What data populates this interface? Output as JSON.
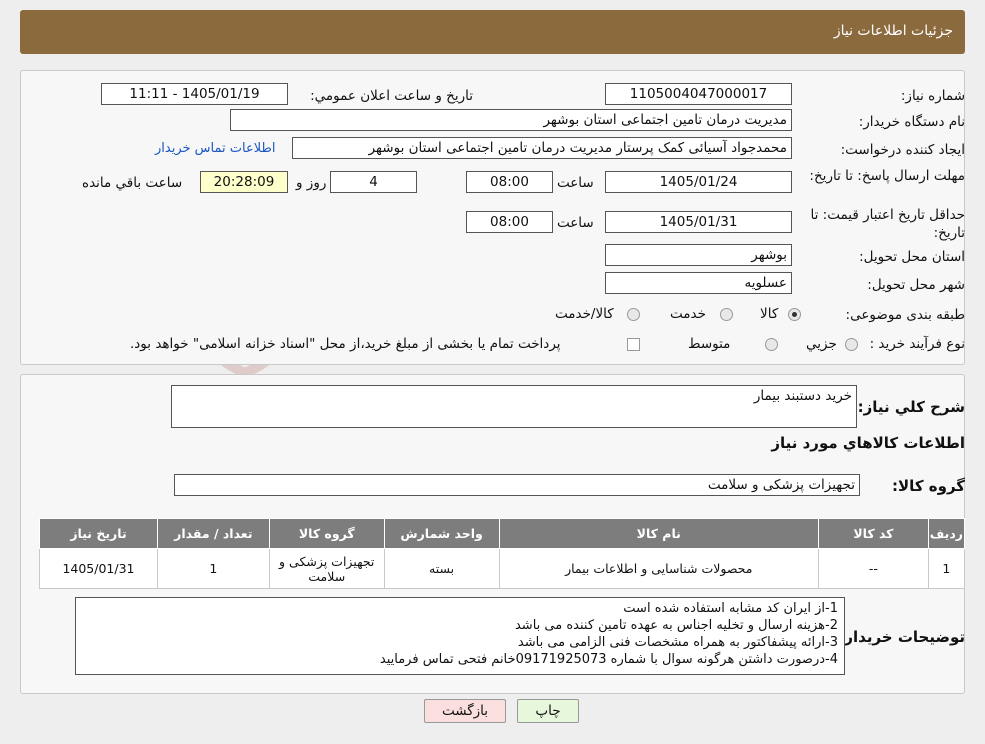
{
  "header": {
    "title": "جزئيات اطلاعات نياز"
  },
  "form": {
    "need_number_label": "شماره نياز:",
    "need_number": "1105004047000017",
    "announce_label": "تاريخ و ساعت اعلان عمومي:",
    "announce_value": "1405/01/19 - 11:11",
    "buyer_org_label": "نام دستگاه خريدار:",
    "buyer_org": "مديريت درمان تامين اجتماعی استان بوشهر",
    "creator_label": "ايجاد کننده درخواست:",
    "creator": "محمدجواد آسیائی کمک پرستار مديريت درمان تامين اجتماعی استان بوشهر",
    "contact_link": "اطلاعات تماس خريدار",
    "deadline_label": "مهلت ارسال پاسخ: تا تاريخ:",
    "deadline_date": "1405/01/24",
    "time_label": "ساعت",
    "deadline_time": "08:00",
    "days_value": "4",
    "days_label": "روز و",
    "remaining_value": "20:28:09",
    "remaining_label": "ساعت باقي مانده",
    "validity_label": "حداقل تاريخ اعتبار قيمت: تا تاريخ:",
    "validity_date": "1405/01/31",
    "validity_time": "08:00",
    "province_label": "استان محل تحويل:",
    "province": "بوشهر",
    "city_label": "شهر محل تحويل:",
    "city": "عسلويه",
    "category_label": "طبقه بندی موضوعی:",
    "category_options": [
      "کالا",
      "خدمت",
      "کالا/خدمت"
    ],
    "purchase_label": "نوع فرآيند خريد :",
    "purchase_options": [
      "جزيي",
      "متوسط"
    ],
    "purchase_note": "پرداخت تمام يا بخشی از مبلغ خريد،از محل \"اسناد خزانه اسلامی\" خواهد بود."
  },
  "details": {
    "summary_label": "شرح کلي نياز:",
    "summary": "خريد دستبند بيمار",
    "goods_title": "اطلاعات کالاهاي مورد نياز",
    "group_label": "گروه کالا:",
    "group": "تجهيزات پزشکی و سلامت",
    "table": {
      "headers": [
        "رديف",
        "کد کالا",
        "نام کالا",
        "واحد شمارش",
        "گروه کالا",
        "تعداد / مقدار",
        "تاريخ نياز"
      ],
      "row": [
        "1",
        "--",
        "محصولات شناسایی و اطلاعات بیمار",
        "بسته",
        "تجهيزات پزشکی و سلامت",
        "1",
        "1405/01/31"
      ]
    },
    "notes_label": "توضيحات خريدار:",
    "notes": [
      "1-از ایران کد مشابه استفاده شده است",
      "2-هزینه ارسال و تخلیه اجناس به عهده تامین کننده می باشد",
      "3-ارائه پیشفاکتور به همراه مشخصات فنی الزامی می باشد",
      "4-درصورت داشتن هرگونه سوال با شماره 09171925073خانم فتحی تماس فرمایید"
    ]
  },
  "buttons": {
    "print": "چاپ",
    "back": "بازگشت"
  },
  "colors": {
    "header": "#8b6a3e",
    "table_header": "#7d7d7d",
    "highlight": "#ffffcc",
    "print_btn": "#e7f7dc",
    "back_btn": "#fbdede"
  }
}
